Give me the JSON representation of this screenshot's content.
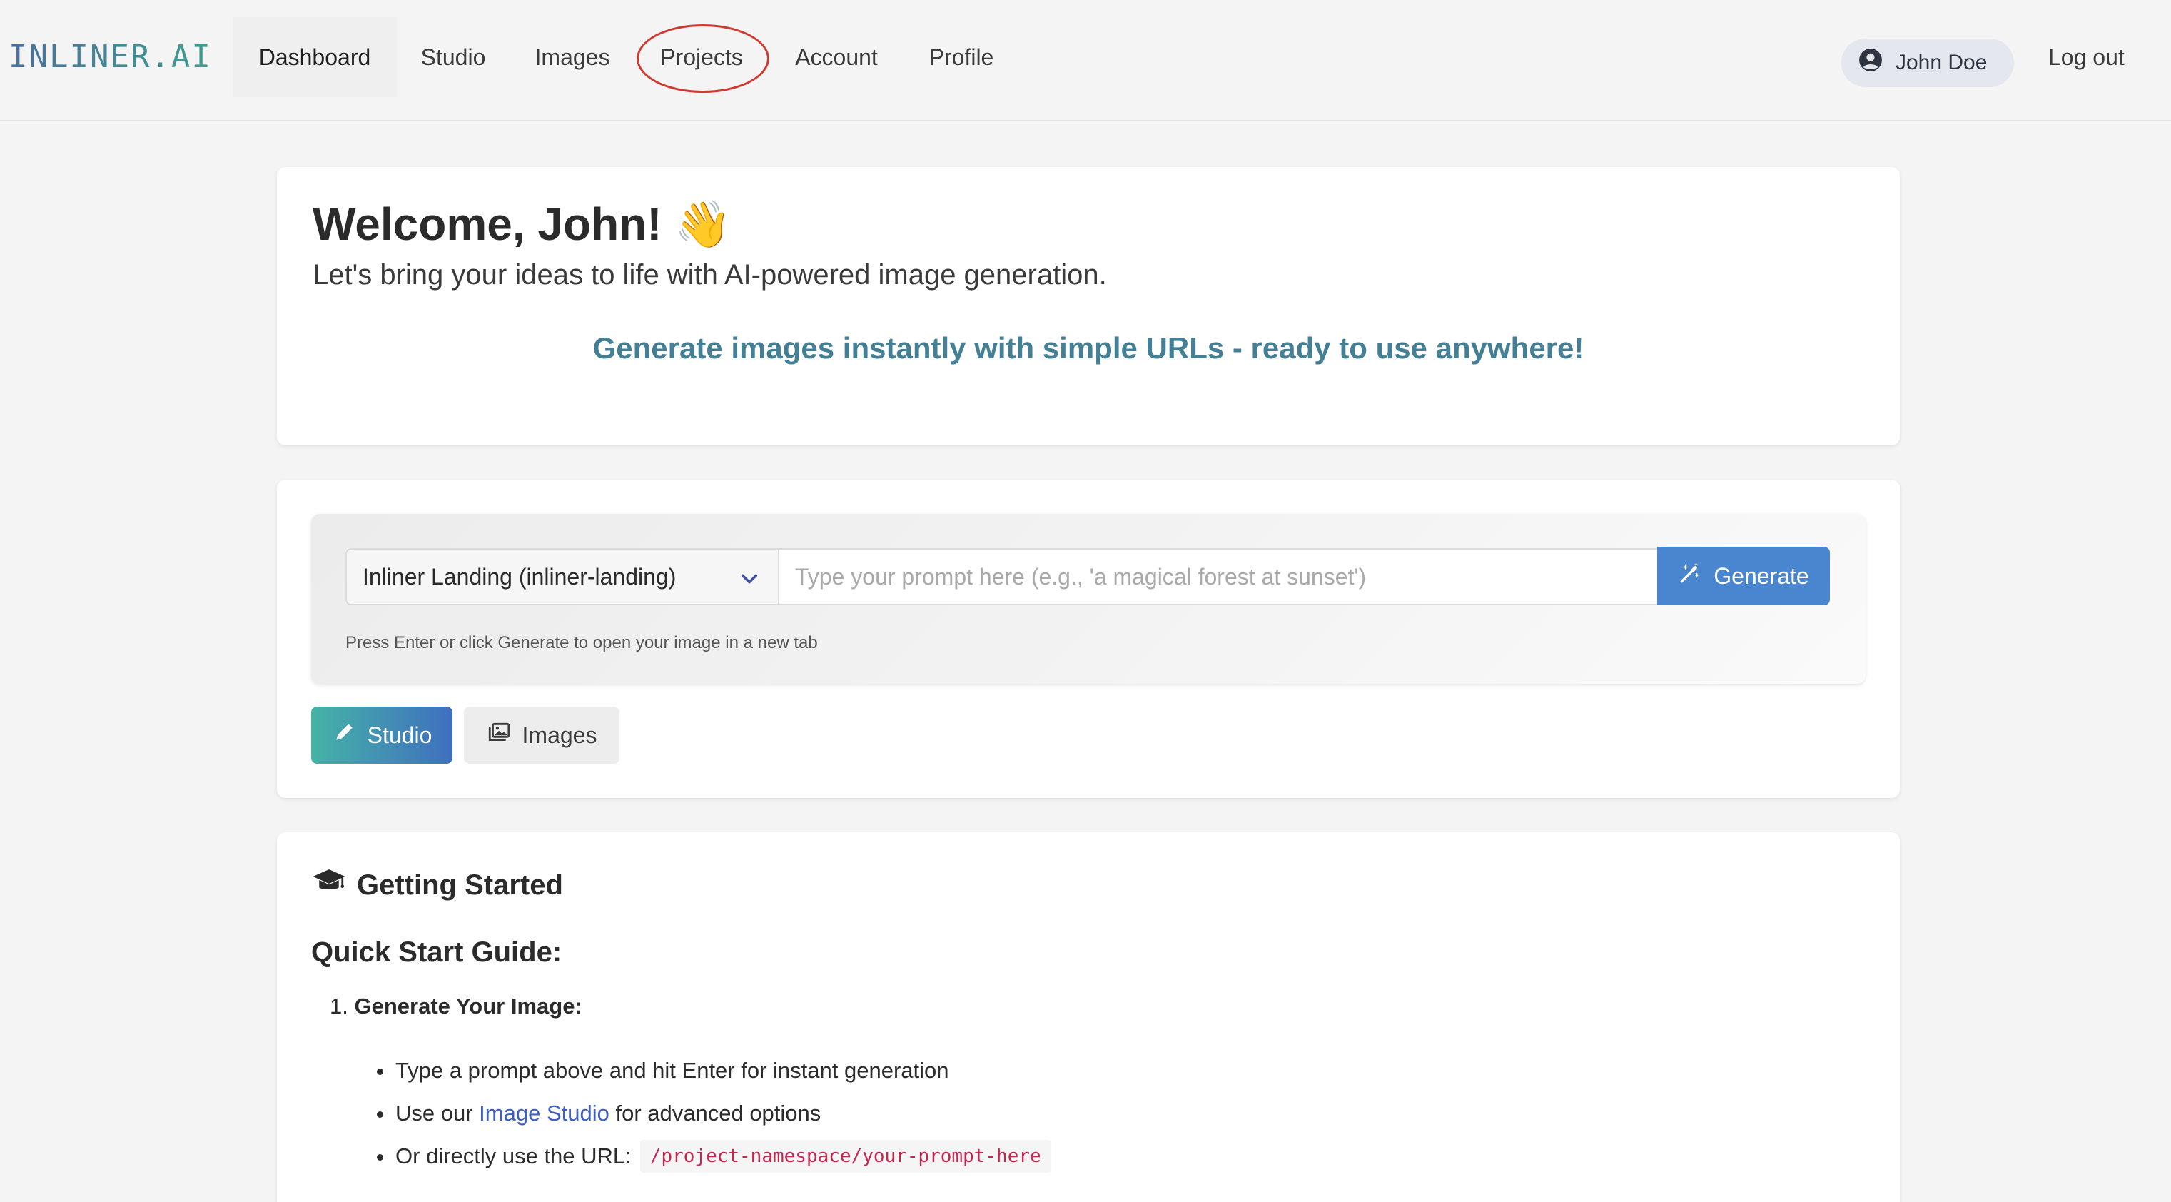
{
  "nav": {
    "brand": "INLINER.AI",
    "items": [
      {
        "label": "Dashboard",
        "active": true
      },
      {
        "label": "Studio"
      },
      {
        "label": "Images"
      },
      {
        "label": "Projects",
        "highlighted": true
      },
      {
        "label": "Account"
      },
      {
        "label": "Profile"
      }
    ],
    "user_name": "John Doe",
    "user_icon": "user-circle-icon",
    "logout_label": "Log out"
  },
  "welcome": {
    "title": "Welcome, John! 👋",
    "subtitle": "Let's bring your ideas to life with AI-powered image generation.",
    "tagline": "Generate images instantly with simple URLs - ready to use anywhere!"
  },
  "prompt": {
    "project_selected": "Inliner Landing (inliner-landing)",
    "input_value": "",
    "input_placeholder": "Type your prompt here (e.g., 'a magical forest at sunset')",
    "generate_label": "Generate",
    "generate_icon": "magic-wand-icon",
    "hint": "Press Enter or click Generate to open your image in a new tab"
  },
  "quick_buttons": {
    "studio_label": "Studio",
    "studio_icon": "pencil-icon",
    "images_label": "Images",
    "images_icon": "images-icon"
  },
  "guide": {
    "heading": "Getting Started",
    "heading_icon": "graduation-cap-icon",
    "subheading": "Quick Start Guide:",
    "step_number": "1.",
    "step_title": "Generate Your Image:",
    "bullet_1": "Type a prompt above and hit Enter for instant generation",
    "bullet_2_prefix": "Use our",
    "bullet_2_link": "Image Studio",
    "bullet_2_suffix": "for advanced options",
    "bullet_3_prefix": "Or directly use the URL:",
    "bullet_3_code": "/project-namespace/your-prompt-here"
  },
  "colors": {
    "accent_blue": "#4a86d0",
    "tagline_teal": "#437f95",
    "highlight_red": "#d0392f",
    "link_blue": "#3d5fc4",
    "code_red": "#c7254e"
  }
}
